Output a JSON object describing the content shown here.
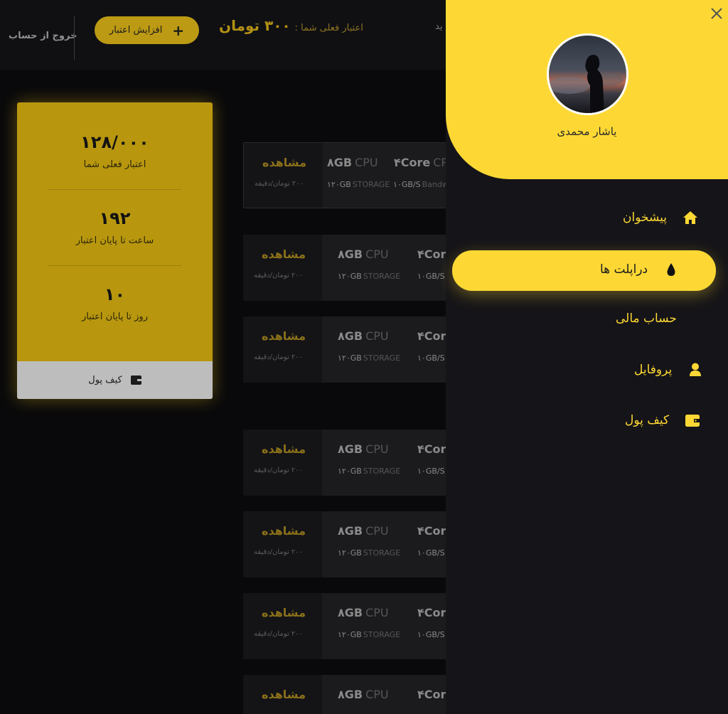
{
  "topbar": {
    "logout_label": "خروج از حساب",
    "add_credit_label": "افزایش اعتبار",
    "credit_label": "اعتبار فعلی شما :",
    "credit_value": "۳۰۰ تومان",
    "fragment_text": "ید"
  },
  "stats": {
    "credit_value": "۱۲۸/۰۰۰",
    "credit_label": "اعتبار فعلی شما",
    "hours_value": "۱۹۲",
    "hours_label": "ساعت تا پایان اعتبار",
    "days_value": "۱۰",
    "days_label": "روز تا پایان اعتبار",
    "wallet_label": "کیف پول"
  },
  "servers": {
    "view_label": "مشاهده",
    "price_label": "۲۰۰ تومان/دقیقه",
    "ram": "۸GB",
    "cpu_unit": "CPU",
    "cores": "۴Core",
    "cores_short": "۴Cor",
    "cp_fragment": "CP",
    "storage": "۱۲۰GB",
    "storage_unit": "STORAGE",
    "bandwidth": "۱۰GB/S",
    "bandwidth_unit": "Bandw",
    "bandwidth_short": "۱۰GB/S"
  },
  "drawer": {
    "user_name": "یاشار محمدی",
    "nav": [
      {
        "label": "پیشخوان",
        "icon": "home-icon"
      },
      {
        "label": "دراپلت ها",
        "icon": "droplet-icon"
      },
      {
        "label": "حساب مالی",
        "icon": "dollar-icon"
      },
      {
        "label": "پروفایل",
        "icon": "user-icon"
      },
      {
        "label": "کیف پول",
        "icon": "wallet-icon"
      }
    ]
  },
  "colors": {
    "accent": "#fdd835",
    "accent_dim": "#b8970f",
    "background": "#09090b",
    "drawer": "#151418"
  }
}
